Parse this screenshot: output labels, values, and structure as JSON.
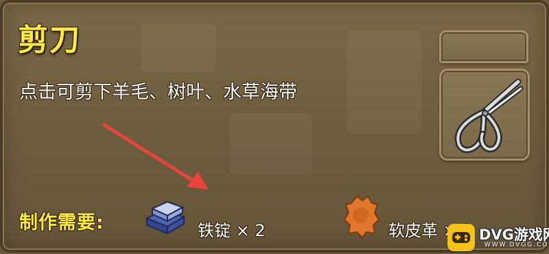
{
  "item": {
    "title": "剪刀",
    "description": "点击可剪下羊毛、树叶、水草海带",
    "icon": "scissors-icon"
  },
  "recipe": {
    "label": "制作需要:",
    "materials": [
      {
        "name": "铁锭",
        "count": "× 2",
        "icon": "iron-ingot-icon"
      },
      {
        "name": "软皮革",
        "count": "× 2",
        "icon": "soft-leather-icon"
      }
    ]
  },
  "watermark": {
    "text": "DVG游戏网",
    "subtext": "WWW.DVGG.COM"
  },
  "colors": {
    "title": "#ffe94a",
    "panel": "#6e5c3f",
    "arrow": "#e8453a"
  }
}
